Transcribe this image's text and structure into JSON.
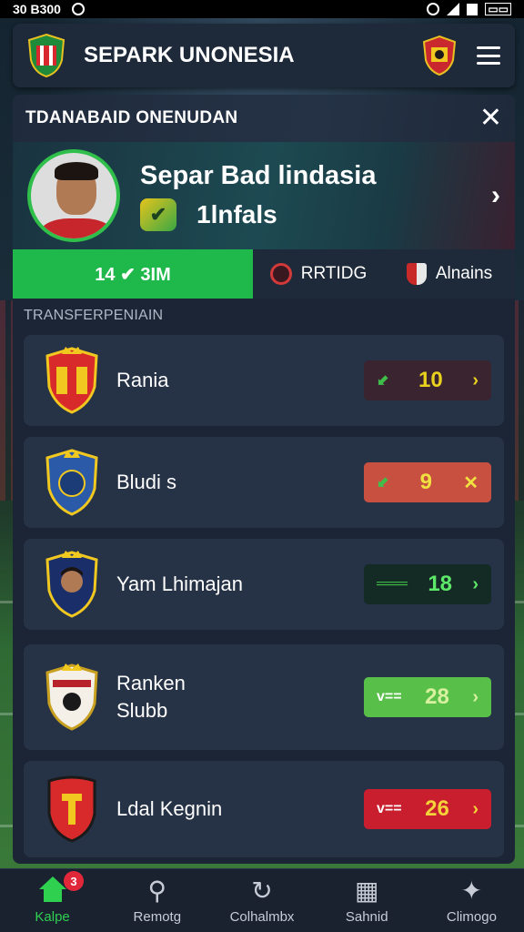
{
  "status_bar": {
    "time": "30 B300"
  },
  "header": {
    "title": "SEPARK UNONESIA"
  },
  "panel": {
    "title": "TDANABAID ONENUDAN",
    "profile": {
      "name": "Separ Bad lindasia",
      "subtitle": "1lnfals"
    },
    "stats": {
      "primary": "14 ✔ 3IM",
      "rating": "RRTIDG",
      "alnairs": "Alnains"
    },
    "section_label": "TRANSFERPENIAIN"
  },
  "rows": [
    {
      "name": "Rania",
      "value": "10",
      "icon": "⬋",
      "arrow": "›",
      "pill_color": "#3a2430",
      "text_color": "#e8d21e",
      "icon_color": "#3fbf4a"
    },
    {
      "name": "Bludi s",
      "value": "9",
      "icon": "⬋",
      "arrow": "✕",
      "pill_color": "#c85040",
      "text_color": "#f0e040",
      "icon_color": "#3fbf4a"
    },
    {
      "name": "Yam Lhimajan",
      "value": "18",
      "icon": "═══",
      "arrow": "›",
      "pill_color": "#142a24",
      "text_color": "#5ee86a",
      "icon_color": "#3fbf4a"
    },
    {
      "name": "Ranken\nSlubb",
      "value": "28",
      "icon": "v==",
      "arrow": "›",
      "pill_color": "#58c048",
      "text_color": "#d8f0a0",
      "icon_color": "#ffffff"
    },
    {
      "name": "Ldal Kegnin",
      "value": "26",
      "icon": "v==",
      "arrow": "›",
      "pill_color": "#c81e2e",
      "text_color": "#f4d23a",
      "icon_color": "#ffffff"
    }
  ],
  "bottom_nav": [
    {
      "label": "Kalpe",
      "badge": "3"
    },
    {
      "label": "Remotg"
    },
    {
      "label": "Colhalmbx"
    },
    {
      "label": "Sahnid"
    },
    {
      "label": "Climogo"
    }
  ]
}
